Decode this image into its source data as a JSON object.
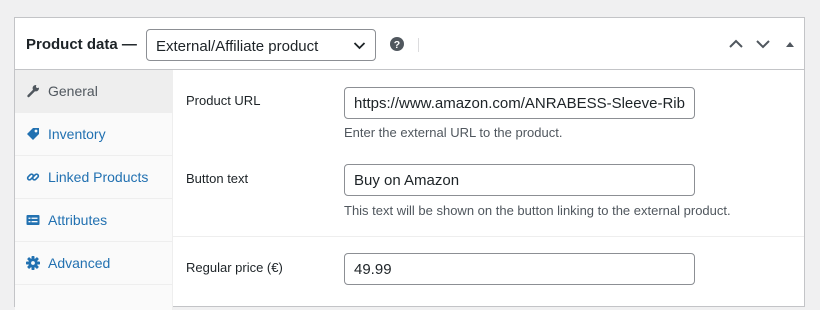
{
  "header": {
    "title": "Product data —",
    "product_type": "External/Affiliate product"
  },
  "tabs": [
    {
      "label": "General",
      "icon": "wrench-icon",
      "active": true
    },
    {
      "label": "Inventory",
      "icon": "tag-icon",
      "active": false
    },
    {
      "label": "Linked Products",
      "icon": "link-icon",
      "active": false
    },
    {
      "label": "Attributes",
      "icon": "list-view-icon",
      "active": false
    },
    {
      "label": "Advanced",
      "icon": "gear-icon",
      "active": false
    }
  ],
  "fields": {
    "product_url": {
      "label": "Product URL",
      "value": "https://www.amazon.com/ANRABESS-Sleeve-Rib",
      "description": "Enter the external URL to the product."
    },
    "button_text": {
      "label": "Button text",
      "value": "Buy on Amazon",
      "description": "This text will be shown on the button linking to the external product."
    },
    "regular_price": {
      "label": "Regular price (€)",
      "value": "49.99"
    }
  },
  "colors": {
    "link": "#2271b1",
    "active_tab_bg": "#eeeeee",
    "border": "#c3c4c7"
  }
}
